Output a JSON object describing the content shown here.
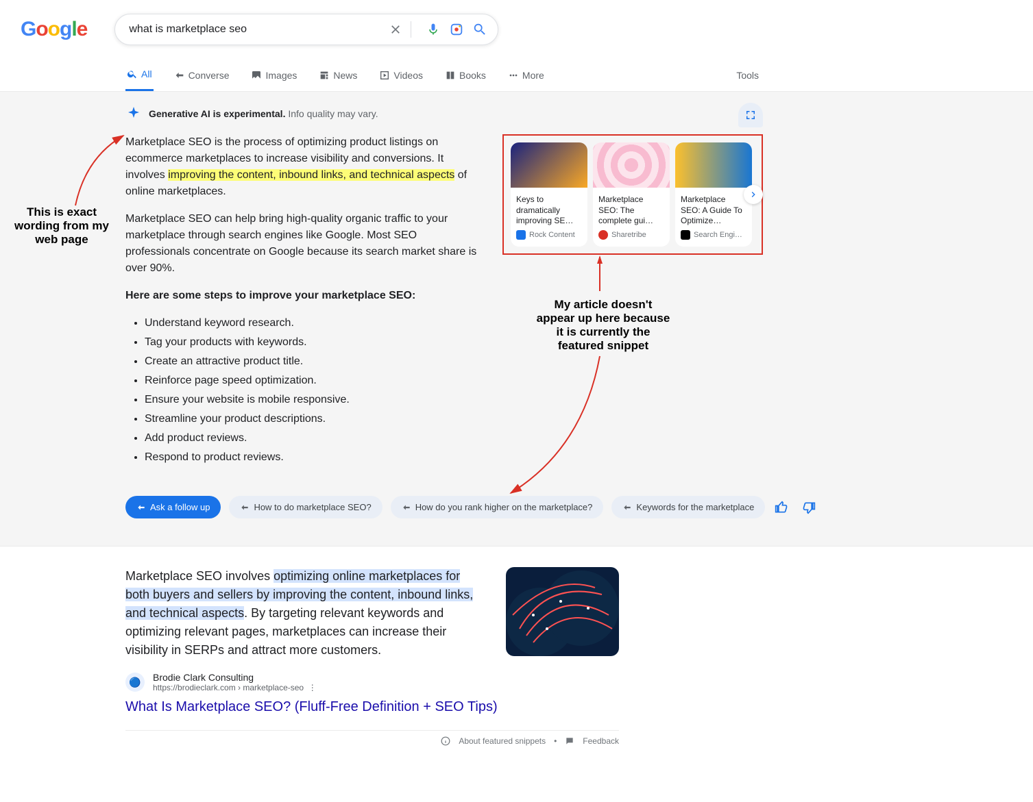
{
  "search": {
    "query": "what is marketplace seo"
  },
  "tabs": {
    "all": "All",
    "converse": "Converse",
    "images": "Images",
    "news": "News",
    "videos": "Videos",
    "books": "Books",
    "more": "More",
    "tools": "Tools"
  },
  "genAI": {
    "bold": "Generative AI is experimental.",
    "rest": "Info quality may vary.",
    "para1_pre": "Marketplace SEO is the process of optimizing product listings on ecommerce marketplaces to increase visibility and conversions. It involves ",
    "para1_hl": "improving the content, inbound links, and technical aspects",
    "para1_post": " of online marketplaces.",
    "para2": "Marketplace SEO can help bring high-quality organic traffic to your marketplace through search engines like Google. Most SEO professionals concentrate on Google because its search market share is over 90%.",
    "steps_heading": "Here are some steps to improve your marketplace SEO:",
    "steps": [
      "Understand keyword research.",
      "Tag your products with keywords.",
      "Create an attractive product title.",
      "Reinforce page speed optimization.",
      "Ensure your website is mobile responsive.",
      "Streamline your product descriptions.",
      "Add product reviews.",
      "Respond to product reviews."
    ]
  },
  "cards": [
    {
      "title": "Keys to dramatically improving SE…",
      "source": "Rock Content"
    },
    {
      "title": "Marketplace SEO: The complete gui…",
      "source": "Sharetribe"
    },
    {
      "title": "Marketplace SEO: A Guide To Optimize…",
      "source": "Search Engi…"
    }
  ],
  "chips": {
    "primary": "Ask a follow up",
    "c1": "How to do marketplace SEO?",
    "c2": "How do you rank higher on the marketplace?",
    "c3": "Keywords for the marketplace"
  },
  "snippet": {
    "text_pre": "Marketplace SEO involves ",
    "text_hl": "optimizing online marketplaces for both buyers and sellers by improving the content, inbound links, and technical aspects",
    "text_post": ". By targeting relevant keywords and optimizing relevant pages, marketplaces can increase their visibility in SERPs and attract more customers.",
    "source_name": "Brodie Clark Consulting",
    "source_url": "https://brodieclark.com › marketplace-seo",
    "title": "What Is Marketplace SEO? (Fluff-Free Definition + SEO Tips)",
    "about": "About featured snippets",
    "feedback": "Feedback"
  },
  "annotations": {
    "left": "This is exact wording from my web page",
    "right": "My article doesn't appear up here because it is currently the featured snippet"
  }
}
